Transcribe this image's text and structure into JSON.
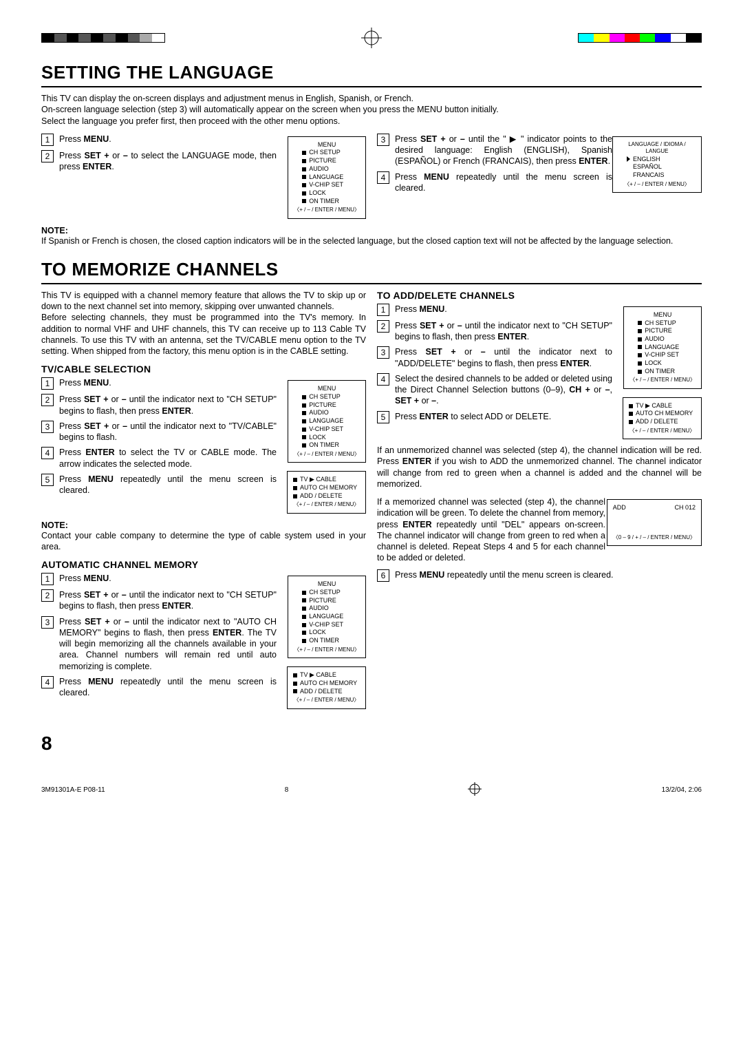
{
  "crops": {
    "left_bar_colors": [
      "#000",
      "#555",
      "#000",
      "#555",
      "#000",
      "#555",
      "#000",
      "#555",
      "#aaa",
      "#fff"
    ],
    "right_bar_colors": [
      "#0ff",
      "#ff0",
      "#f0f",
      "#f00",
      "#0f0",
      "#00f",
      "#fff",
      "#000"
    ]
  },
  "h1_lang": "SETTING THE LANGUAGE",
  "p_lang_intro1": "This TV can display the on-screen displays and adjustment menus in English, Spanish, or French.",
  "p_lang_intro2": "On-screen language selection (step 3) will automatically appear on the screen when you press the MENU button initially.",
  "p_lang_intro3": "Select the language you prefer first, then proceed with the other menu options.",
  "lang_steps_left": [
    {
      "n": "1",
      "t": "Press <b>MENU</b>."
    },
    {
      "n": "2",
      "t": "Press <b>SET +</b> or <b>–</b> to select the LANGUAGE mode, then press <b>ENTER</b>."
    }
  ],
  "lang_steps_right": [
    {
      "n": "3",
      "t": "Press <b>SET +</b> or <b>–</b> until the \" ▶ \" indicator points to the desired language: English (ENGLISH), Spanish (ESPAÑOL) or French (FRANCAIS), then press <b>ENTER</b>."
    },
    {
      "n": "4",
      "t": "Press <b>MENU</b> repeatedly until the menu screen is cleared."
    }
  ],
  "note_lang": "NOTE:",
  "note_lang_text": "If Spanish or French is chosen, the closed caption indicators will be in the selected language, but the closed caption text will not be affected by the language selection.",
  "osd_menu_title": "MENU",
  "osd_menu_items": [
    "CH SETUP",
    "PICTURE",
    "AUDIO",
    "LANGUAGE",
    "V-CHIP SET",
    "LOCK",
    "ON TIMER"
  ],
  "osd_hint": "〈+ / – / ENTER / MENU〉",
  "osd_lang_title": "LANGUAGE / IDIOMA / LANGUE",
  "osd_lang_items": [
    "ENGLISH",
    "ESPAÑOL",
    "FRANCAIS"
  ],
  "h1_mem": "TO MEMORIZE CHANNELS",
  "mem_intro": "This TV is equipped with a channel memory feature that allows the TV to skip up or down to the next channel set into memory, skipping over unwanted channels.",
  "mem_intro2": "Before selecting channels, they must be programmed into the TV's memory. In addition to normal VHF and UHF channels, this TV can receive up to 113 Cable TV channels. To use this TV with an antenna, set the TV/CABLE menu option to the TV setting. When shipped from the factory, this menu option is in the CABLE setting.",
  "sub_tvcable": "TV/CABLE SELECTION",
  "tvcable_steps": [
    {
      "n": "1",
      "t": "Press <b>MENU</b>."
    },
    {
      "n": "2",
      "t": "Press <b>SET +</b> or <b>–</b> until the indicator next to \"CH SETUP\" begins to flash, then press <b>ENTER</b>."
    },
    {
      "n": "3",
      "t": "Press <b>SET +</b> or <b>–</b> until the indicator next to \"TV/CABLE\" begins to flash."
    },
    {
      "n": "4",
      "t": "Press <b>ENTER</b> to select the TV or CABLE mode. The arrow indicates the selected mode."
    },
    {
      "n": "5",
      "t": "Press <b>MENU</b> repeatedly until the menu screen is cleared."
    }
  ],
  "note_tvcable": "NOTE:",
  "note_tvcable_text": "Contact your cable company to determine the type of cable system used in your area.",
  "sub_auto": "AUTOMATIC CHANNEL MEMORY",
  "auto_steps": [
    {
      "n": "1",
      "t": "Press <b>MENU</b>."
    },
    {
      "n": "2",
      "t": "Press <b>SET +</b> or <b>–</b> until the indicator next to \"CH SETUP\" begins to flash, then press <b>ENTER</b>."
    },
    {
      "n": "3",
      "t": "Press <b>SET +</b> or <b>–</b> until the indicator next to \"AUTO CH MEMORY\" begins to flash, then press <b>ENTER</b>. The TV will begin memorizing all the channels available in your area. Channel numbers will remain red until auto memorizing is complete."
    },
    {
      "n": "4",
      "t": "Press <b>MENU</b> repeatedly until the menu screen is cleared."
    }
  ],
  "sub_add": "TO ADD/DELETE CHANNELS",
  "add_steps": [
    {
      "n": "1",
      "t": "Press <b>MENU</b>."
    },
    {
      "n": "2",
      "t": "Press <b>SET +</b> or <b>–</b> until the indicator next to \"CH SETUP\" begins to flash, then press <b>ENTER</b>."
    },
    {
      "n": "3",
      "t": "Press <b>SET +</b> or <b>–</b> until the indicator next to \"ADD/DELETE\" begins to flash, then press <b>ENTER</b>."
    },
    {
      "n": "4",
      "t": "Select the desired channels to be added or deleted using the Direct Channel Selection buttons (0–9), <b>CH +</b> or <b>–</b>, <b>SET +</b> or <b>–</b>."
    },
    {
      "n": "5",
      "t": "Press <b>ENTER</b> to select ADD or DELETE."
    }
  ],
  "add_para1": "If an unmemorized channel was selected (step 4), the channel indication will be red. Press <b>ENTER</b> if you wish to ADD the unmemorized channel. The channel indicator will change from red to green when a channel is added and the channel will be memorized.",
  "add_para2": "If a memorized channel was selected (step 4), the channel indication will be green. To delete the channel from memory, press <b>ENTER</b> repeatedly until \"DEL\" appears on-screen. The channel indicator will change from green to red when a channel is deleted. Repeat Steps 4 and 5 for each channel to be added or deleted.",
  "add_step6": {
    "n": "6",
    "t": "Press <b>MENU</b> repeatedly until the menu screen is cleared."
  },
  "osd_tvcable_items": [
    "TV ▶ CABLE",
    "AUTO CH MEMORY",
    "ADD / DELETE"
  ],
  "osd_add": {
    "l": "ADD",
    "r": "CH 012"
  },
  "osd_add_hint": "〈0 – 9 / + / – / ENTER / MENU〉",
  "page_num": "8",
  "footer_left": "3M91301A-E P08-11",
  "footer_center": "8",
  "footer_right": "13/2/04, 2:06"
}
